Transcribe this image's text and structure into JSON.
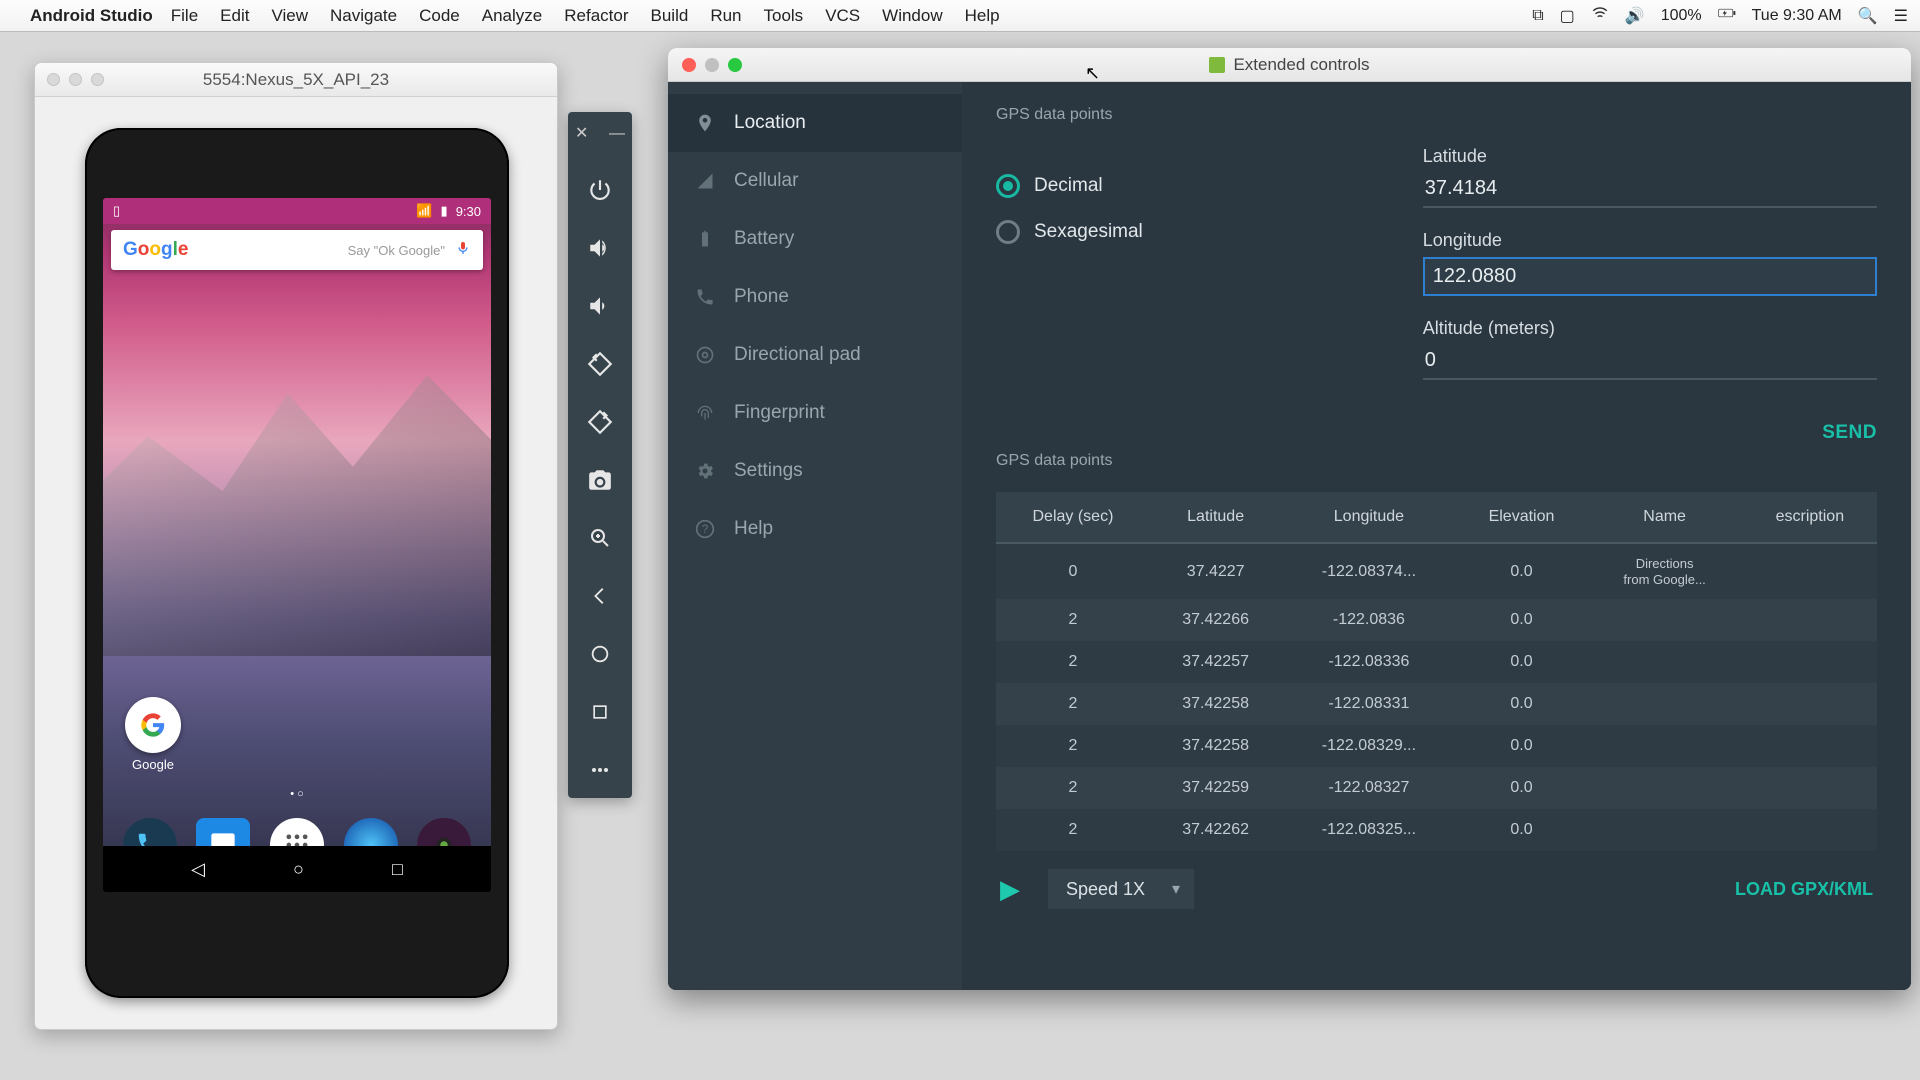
{
  "menubar": {
    "app": "Android Studio",
    "items": [
      "File",
      "Edit",
      "View",
      "Navigate",
      "Code",
      "Analyze",
      "Refactor",
      "Build",
      "Run",
      "Tools",
      "VCS",
      "Window",
      "Help"
    ],
    "battery": "100%",
    "clock": "Tue 9:30 AM"
  },
  "emulator": {
    "title": "5554:Nexus_5X_API_23",
    "status_time": "9:30",
    "search_logo": "Google",
    "search_hint": "Say \"Ok Google\"",
    "google_label": "Google"
  },
  "extended": {
    "title": "Extended controls",
    "sidebar": [
      {
        "icon": "location",
        "label": "Location"
      },
      {
        "icon": "cellular",
        "label": "Cellular"
      },
      {
        "icon": "battery",
        "label": "Battery"
      },
      {
        "icon": "phone",
        "label": "Phone"
      },
      {
        "icon": "dpad",
        "label": "Directional pad"
      },
      {
        "icon": "fingerprint",
        "label": "Fingerprint"
      },
      {
        "icon": "settings",
        "label": "Settings"
      },
      {
        "icon": "help",
        "label": "Help"
      }
    ],
    "gps_label": "GPS data points",
    "format": {
      "decimal": "Decimal",
      "sexagesimal": "Sexagesimal",
      "selected": "decimal"
    },
    "latitude": {
      "label": "Latitude",
      "value": "37.4184"
    },
    "longitude": {
      "label": "Longitude",
      "value": "122.0880"
    },
    "altitude": {
      "label": "Altitude (meters)",
      "value": "0"
    },
    "send": "SEND",
    "table": {
      "headers": [
        "Delay (sec)",
        "Latitude",
        "Longitude",
        "Elevation",
        "Name",
        "escription"
      ],
      "rows": [
        {
          "delay": "0",
          "lat": "37.4227",
          "lon": "-122.08374...",
          "elev": "0.0",
          "name": "Directions from Google...",
          "desc": ""
        },
        {
          "delay": "2",
          "lat": "37.42266",
          "lon": "-122.0836",
          "elev": "0.0",
          "name": "",
          "desc": ""
        },
        {
          "delay": "2",
          "lat": "37.42257",
          "lon": "-122.08336",
          "elev": "0.0",
          "name": "",
          "desc": ""
        },
        {
          "delay": "2",
          "lat": "37.42258",
          "lon": "-122.08331",
          "elev": "0.0",
          "name": "",
          "desc": ""
        },
        {
          "delay": "2",
          "lat": "37.42258",
          "lon": "-122.08329...",
          "elev": "0.0",
          "name": "",
          "desc": ""
        },
        {
          "delay": "2",
          "lat": "37.42259",
          "lon": "-122.08327",
          "elev": "0.0",
          "name": "",
          "desc": ""
        },
        {
          "delay": "2",
          "lat": "37.42262",
          "lon": "-122.08325...",
          "elev": "0.0",
          "name": "",
          "desc": ""
        }
      ]
    },
    "speed": "Speed 1X",
    "load": "LOAD GPX/KML"
  }
}
